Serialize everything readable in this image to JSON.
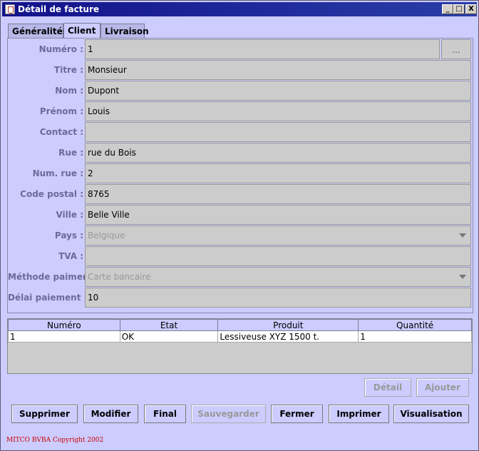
{
  "window": {
    "title": "Détail de facture",
    "minimize": "_",
    "maximize": "□",
    "close": "X"
  },
  "tabs": [
    {
      "label": "Généralités"
    },
    {
      "label": "Client"
    },
    {
      "label": "Livraison"
    }
  ],
  "form": {
    "numero_label": "Numéro :",
    "numero_value": "1",
    "ellipsis": "...",
    "titre_label": "Titre :",
    "titre_value": "Monsieur",
    "nom_label": "Nom :",
    "nom_value": "Dupont",
    "prenom_label": "Prénom :",
    "prenom_value": "Louis",
    "contact_label": "Contact :",
    "contact_value": "",
    "rue_label": "Rue :",
    "rue_value": "rue du Bois",
    "numrue_label": "Num. rue :",
    "numrue_value": "2",
    "codepostal_label": "Code postal :",
    "codepostal_value": "8765",
    "ville_label": "Ville :",
    "ville_value": "Belle Ville",
    "pays_label": "Pays :",
    "pays_value": "Belgique",
    "tva_label": "TVA :",
    "tva_value": "",
    "methode_label": "Méthode paiment :",
    "methode_value": "Carte bancaire",
    "delai_label": "Délai paiement :",
    "delai_value": "10"
  },
  "table": {
    "headers": [
      "Numéro",
      "Etat",
      "Produit",
      "Quantité"
    ],
    "rows": [
      [
        "1",
        "OK",
        "Lessiveuse XYZ 1500 t.",
        "1"
      ]
    ]
  },
  "buttons": {
    "detail": "Détail",
    "ajouter": "Ajouter",
    "supprimer": "Supprimer",
    "modifier": "Modifier",
    "final": "Final",
    "sauvegarder": "Sauvegarder",
    "fermer": "Fermer",
    "imprimer": "Imprimer",
    "visualisation": "Visualisation"
  },
  "footer": "MITCO BVBA Copyright 2002",
  "colors": {
    "background": "#ccccff",
    "titlebar": "#12128a",
    "label": "#6b6b99",
    "footer": "#cc0000"
  }
}
